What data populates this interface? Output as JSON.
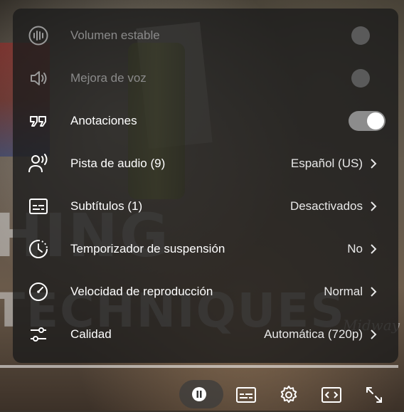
{
  "settings_menu": {
    "items": [
      {
        "label": "Volumen estable",
        "value": "",
        "state": "off",
        "enabled": false,
        "icon": "stable-volume-icon"
      },
      {
        "label": "Mejora de voz",
        "value": "",
        "state": "off",
        "enabled": false,
        "icon": "voice-boost-icon"
      },
      {
        "label": "Anotaciones",
        "value": "",
        "state": "on",
        "enabled": true,
        "icon": "annotations-icon"
      },
      {
        "label": "Pista de audio (9)",
        "value": "Español (US)",
        "icon": "audio-track-icon"
      },
      {
        "label": "Subtítulos (1)",
        "value": "Desactivados",
        "icon": "subtitles-icon"
      },
      {
        "label": "Temporizador de suspensión",
        "value": "No",
        "icon": "sleep-timer-icon"
      },
      {
        "label": "Velocidad de reproducción",
        "value": "Normal",
        "icon": "playback-speed-icon"
      },
      {
        "label": "Calidad",
        "value": "Automática (720p)",
        "icon": "quality-icon"
      }
    ]
  },
  "controls": {
    "buttons": [
      "pause-icon",
      "subtitles-icon",
      "gear-icon",
      "theater-mode-icon",
      "fullscreen-icon"
    ]
  },
  "colors": {
    "panel_bg": "#1c1c1c",
    "toggle_on_track": "#8c8c8c",
    "toggle_knob": "#ffffff",
    "disabled_text": "#8a8a8a"
  }
}
